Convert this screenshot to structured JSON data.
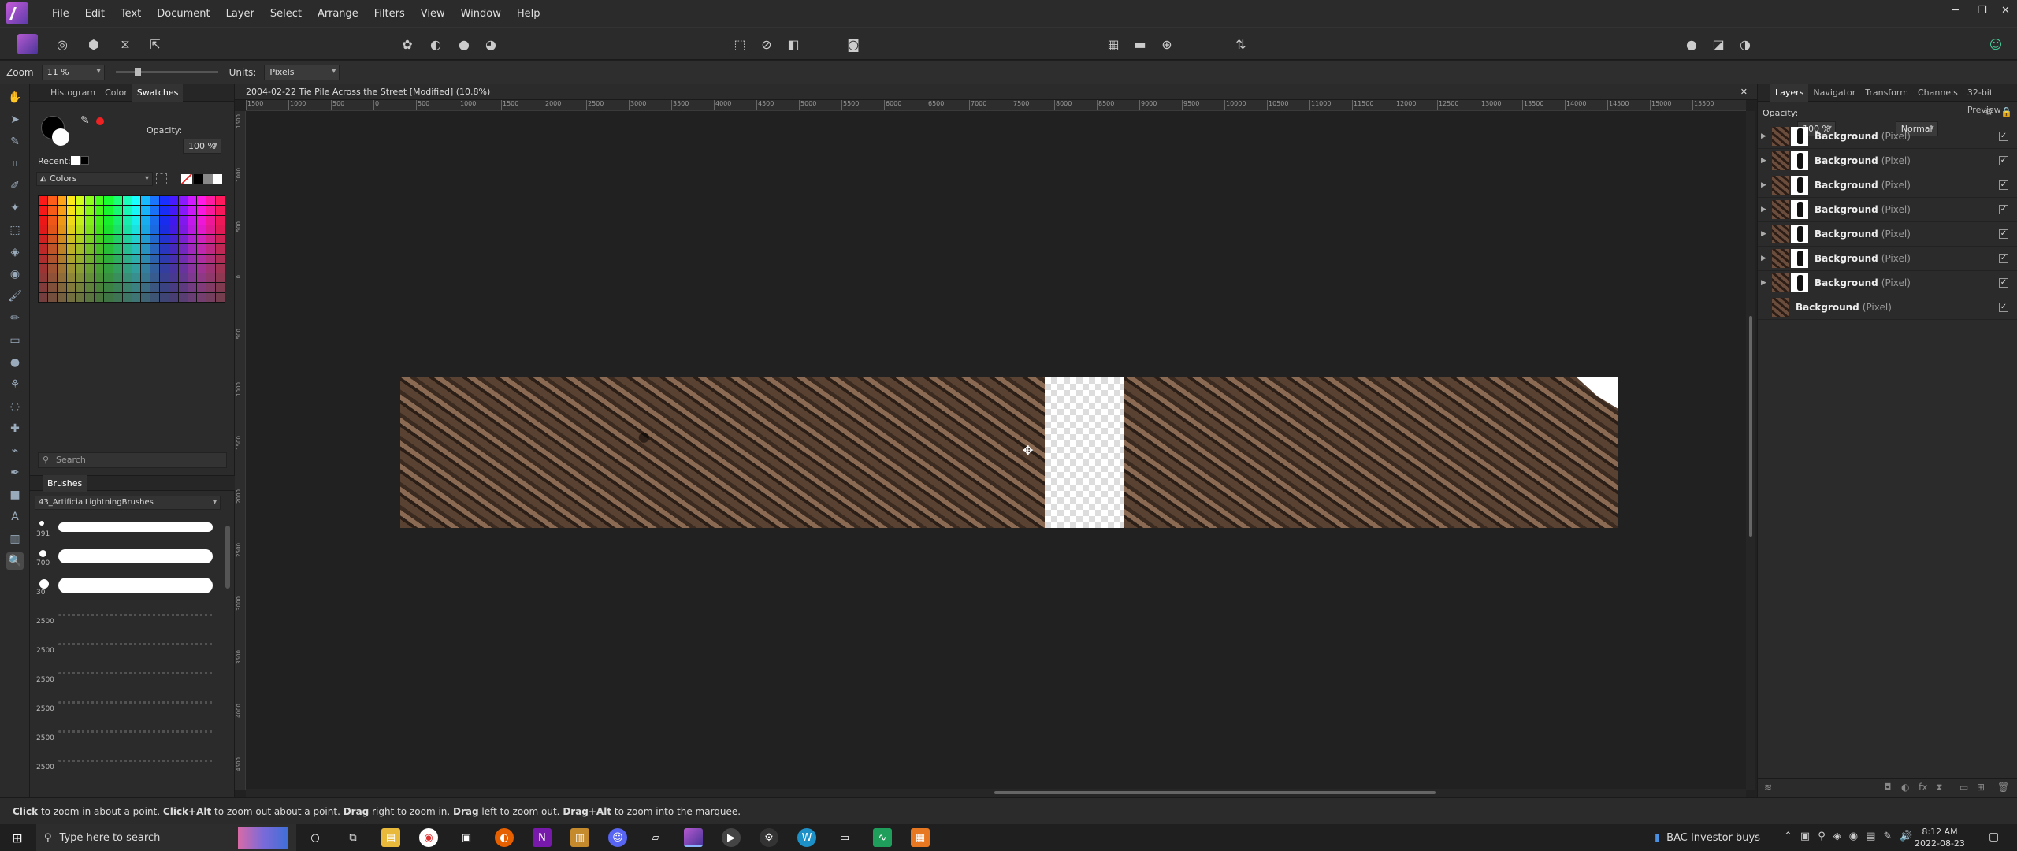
{
  "app": {
    "menus": [
      "File",
      "Edit",
      "Text",
      "Document",
      "Layer",
      "Select",
      "Arrange",
      "Filters",
      "View",
      "Window",
      "Help"
    ]
  },
  "context": {
    "zoom_label": "Zoom",
    "zoom_value": "11 %",
    "units_label": "Units:",
    "units_value": "Pixels"
  },
  "left_panel": {
    "tabs": [
      "Histogram",
      "Color",
      "Swatches"
    ],
    "opacity_label": "Opacity:",
    "opacity_value": "100 %",
    "recent_label": "Recent:",
    "palette_name": "Colors",
    "search_placeholder": "Search",
    "brushes_tab": "Brushes",
    "brush_category": "43_ArtificialLightningBrushes",
    "brush_sizes": [
      "391",
      "700",
      "30",
      "2500",
      "2500",
      "2500",
      "2500",
      "2500",
      "2500"
    ]
  },
  "document": {
    "title": "2004-02-22 Tie Pile Across the Street [Modified] (10.8%)",
    "ruler_ticks": [
      "1500",
      "1000",
      "500",
      "0",
      "500",
      "1000",
      "1500",
      "2000",
      "2500",
      "3000",
      "3500",
      "4000",
      "4500",
      "5000",
      "5500",
      "6000",
      "6500",
      "7000",
      "7500",
      "8000",
      "8500",
      "9000",
      "9500",
      "10000",
      "10500",
      "11000",
      "11500",
      "12000",
      "12500",
      "13000",
      "13500",
      "14000",
      "14500",
      "15000",
      "15500"
    ],
    "vruler_ticks": [
      "1500",
      "1000",
      "500",
      "0",
      "500",
      "1000",
      "1500",
      "2000",
      "2500",
      "3000",
      "3500",
      "4000",
      "4500"
    ]
  },
  "right_panel": {
    "tabs": [
      "Layers",
      "Navigator",
      "Transform",
      "Channels",
      "32-bit Preview"
    ],
    "opacity_label": "Opacity:",
    "opacity_value": "100 %",
    "blend_mode": "Normal",
    "layers": [
      {
        "name": "Background",
        "type": "(Pixel)"
      },
      {
        "name": "Background",
        "type": "(Pixel)"
      },
      {
        "name": "Background",
        "type": "(Pixel)"
      },
      {
        "name": "Background",
        "type": "(Pixel)"
      },
      {
        "name": "Background",
        "type": "(Pixel)"
      },
      {
        "name": "Background",
        "type": "(Pixel)"
      },
      {
        "name": "Background",
        "type": "(Pixel)"
      },
      {
        "name": "Background",
        "type": "(Pixel)"
      }
    ]
  },
  "status": {
    "segments": [
      {
        "t": "Click",
        "b": true
      },
      {
        "t": " to zoom in about a point. ",
        "b": false
      },
      {
        "t": "Click+Alt",
        "b": true
      },
      {
        "t": " to zoom out about a point. ",
        "b": false
      },
      {
        "t": "Drag",
        "b": true
      },
      {
        "t": " right to zoom in. ",
        "b": false
      },
      {
        "t": "Drag",
        "b": true
      },
      {
        "t": " left to zoom out. ",
        "b": false
      },
      {
        "t": "Drag+Alt",
        "b": true
      },
      {
        "t": " to zoom into the marquee.",
        "b": false
      }
    ]
  },
  "taskbar": {
    "search_placeholder": "Type here to search",
    "ticker": "BAC  Investor buys",
    "time": "8:12 AM",
    "date": "2022-08-23"
  },
  "colors": {
    "accent": "#a35bd0",
    "panel": "#2b2b2b",
    "canvas": "#212121"
  }
}
